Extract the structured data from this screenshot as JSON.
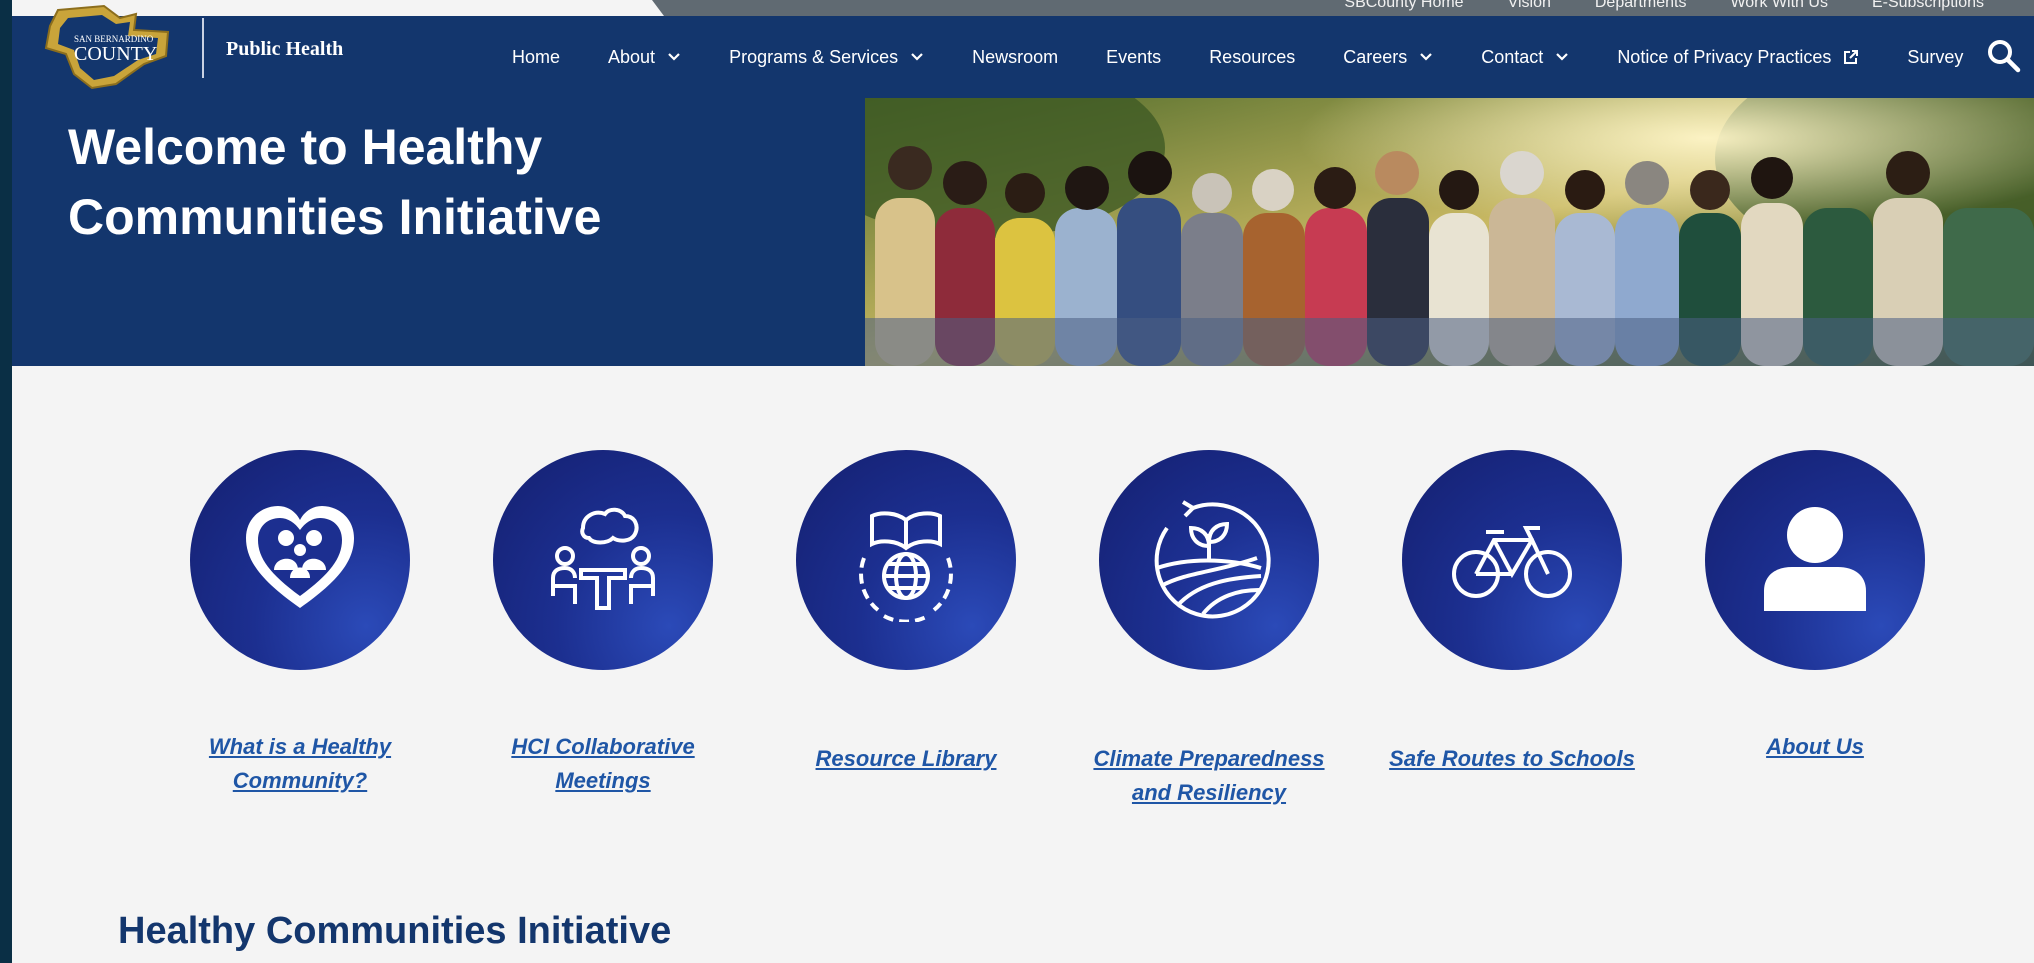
{
  "utility_links": [
    "SBCounty Home",
    "Vision",
    "Departments",
    "Work With Us",
    "E-Subscriptions"
  ],
  "header": {
    "logo_line1": "SAN BERNARDINO",
    "logo_line2": "COUNTY",
    "department": "Public Health"
  },
  "nav": {
    "home": "Home",
    "about": "About",
    "programs": "Programs & Services",
    "newsroom": "Newsroom",
    "events": "Events",
    "resources": "Resources",
    "careers": "Careers",
    "contact": "Contact",
    "privacy": "Notice of Privacy Practices",
    "survey": "Survey"
  },
  "hero": {
    "title_line1": "Welcome to Healthy",
    "title_line2": "Communities Initiative"
  },
  "cards": [
    {
      "line1": "What is a Healthy",
      "line2": "Community?",
      "icon": "heart-family-icon"
    },
    {
      "line1": "HCI Collaborative",
      "line2": "Meetings",
      "icon": "meeting-table-icon"
    },
    {
      "line1": "Resource Library",
      "line2": "",
      "icon": "globe-book-icon"
    },
    {
      "line1": "Climate Preparedness",
      "line2": "and Resiliency",
      "icon": "sprout-field-icon"
    },
    {
      "line1": "Safe Routes to Schools",
      "line2": "",
      "icon": "bicycle-icon"
    },
    {
      "line1": "About Us",
      "line2": "",
      "icon": "person-icon"
    }
  ],
  "section_title": "Healthy Communities Initiative",
  "colors": {
    "navy": "#13366d",
    "link": "#1f56a6",
    "circle_dark": "#141f6f",
    "circle_light": "#2b4ab8",
    "logo_gold": "#c9a43a"
  }
}
